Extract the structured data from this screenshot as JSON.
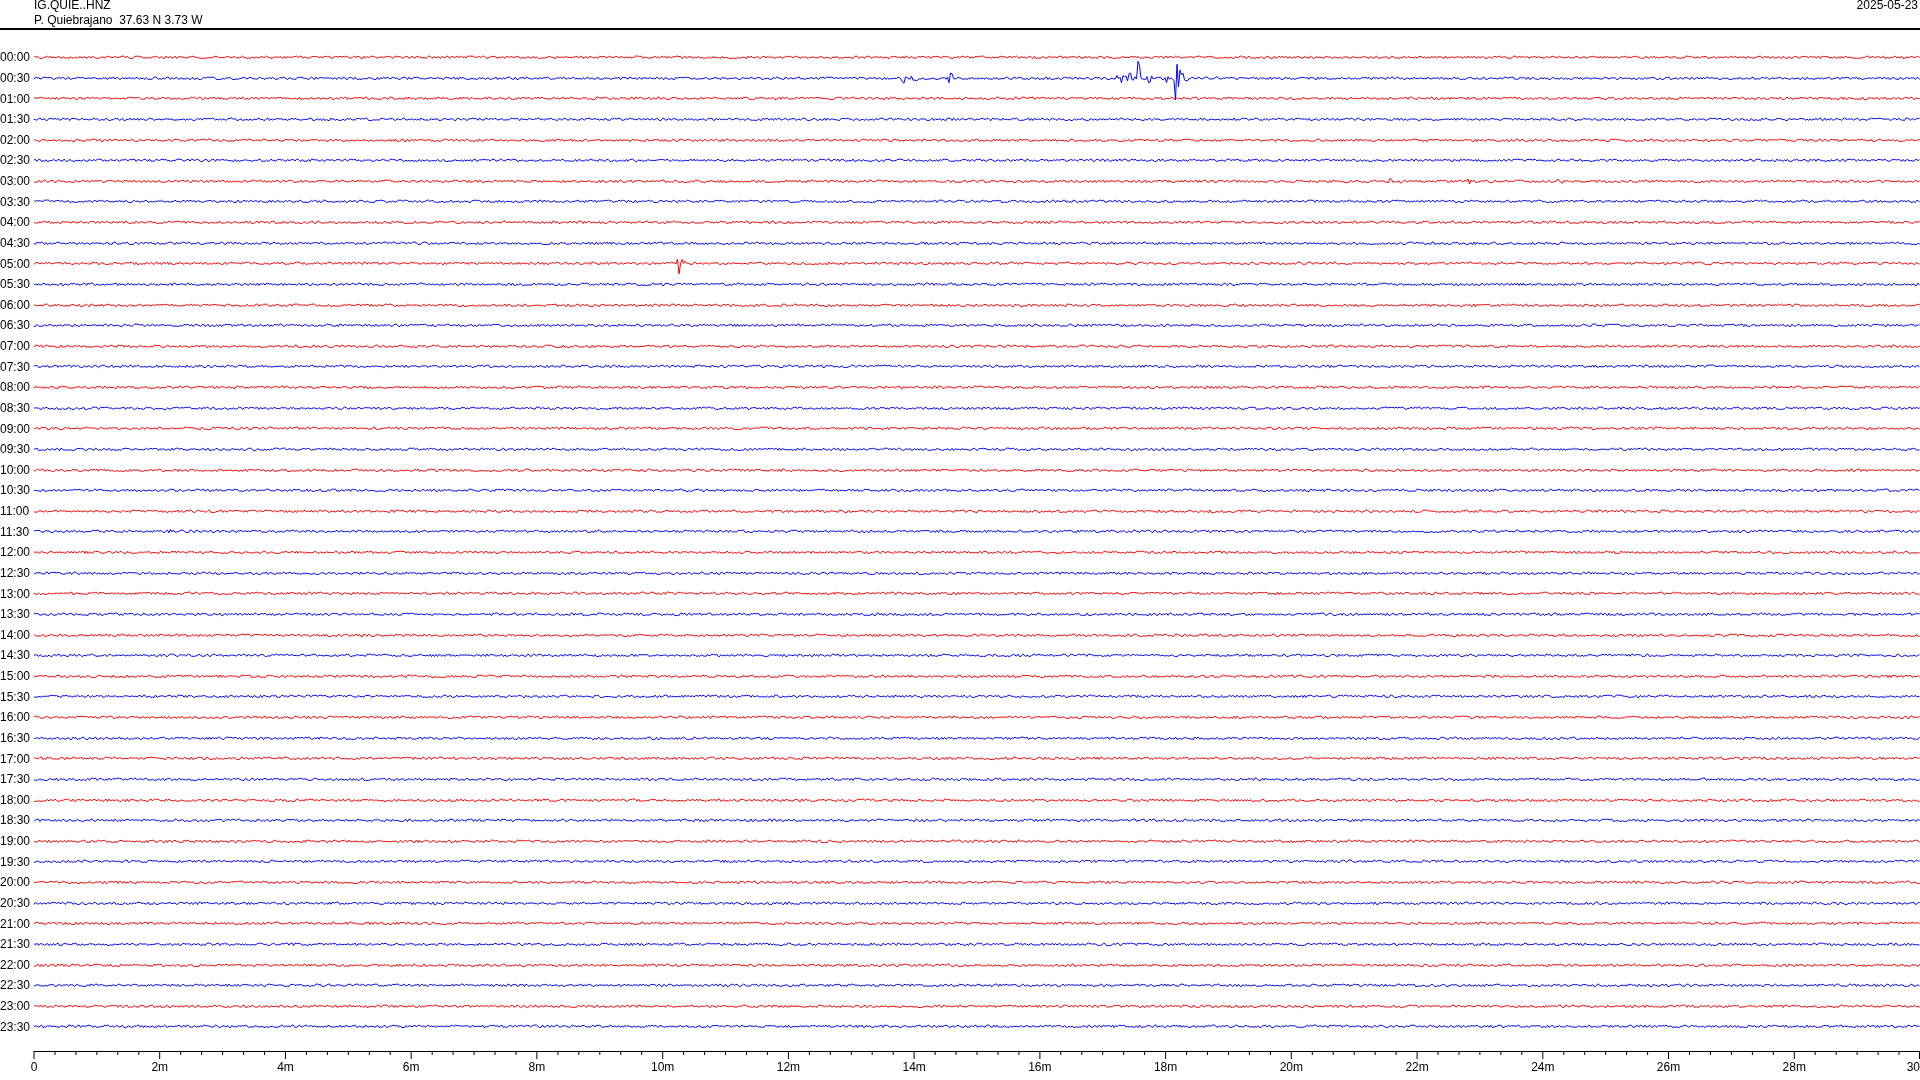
{
  "header": {
    "channel": "IG.QUIE..HNZ",
    "station": "P. Quiebrajano  37.63 N 3.73 W",
    "date": "2025-05-23"
  },
  "traces": [
    {
      "label": "00:00",
      "color": "#ff0000"
    },
    {
      "label": "00:30",
      "color": "#0000ff"
    },
    {
      "label": "01:00",
      "color": "#ff0000"
    },
    {
      "label": "01:30",
      "color": "#0000ff"
    },
    {
      "label": "02:00",
      "color": "#ff0000"
    },
    {
      "label": "02:30",
      "color": "#0000ff"
    },
    {
      "label": "03:00",
      "color": "#ff0000"
    },
    {
      "label": "03:30",
      "color": "#0000ff"
    },
    {
      "label": "04:00",
      "color": "#ff0000"
    },
    {
      "label": "04:30",
      "color": "#0000ff"
    },
    {
      "label": "05:00",
      "color": "#ff0000"
    },
    {
      "label": "05:30",
      "color": "#0000ff"
    },
    {
      "label": "06:00",
      "color": "#ff0000"
    },
    {
      "label": "06:30",
      "color": "#0000ff"
    },
    {
      "label": "07:00",
      "color": "#ff0000"
    },
    {
      "label": "07:30",
      "color": "#0000ff"
    },
    {
      "label": "08:00",
      "color": "#ff0000"
    },
    {
      "label": "08:30",
      "color": "#0000ff"
    },
    {
      "label": "09:00",
      "color": "#ff0000"
    },
    {
      "label": "09:30",
      "color": "#0000ff"
    },
    {
      "label": "10:00",
      "color": "#ff0000"
    },
    {
      "label": "10:30",
      "color": "#0000ff"
    },
    {
      "label": "11:00",
      "color": "#ff0000"
    },
    {
      "label": "11:30",
      "color": "#0000ff"
    },
    {
      "label": "12:00",
      "color": "#ff0000"
    },
    {
      "label": "12:30",
      "color": "#0000ff"
    },
    {
      "label": "13:00",
      "color": "#ff0000"
    },
    {
      "label": "13:30",
      "color": "#0000ff"
    },
    {
      "label": "14:00",
      "color": "#ff0000"
    },
    {
      "label": "14:30",
      "color": "#0000ff"
    },
    {
      "label": "15:00",
      "color": "#ff0000"
    },
    {
      "label": "15:30",
      "color": "#0000ff"
    },
    {
      "label": "16:00",
      "color": "#ff0000"
    },
    {
      "label": "16:30",
      "color": "#0000ff"
    },
    {
      "label": "17:00",
      "color": "#ff0000"
    },
    {
      "label": "17:30",
      "color": "#0000ff"
    },
    {
      "label": "18:00",
      "color": "#ff0000"
    },
    {
      "label": "18:30",
      "color": "#0000ff"
    },
    {
      "label": "19:00",
      "color": "#ff0000"
    },
    {
      "label": "19:30",
      "color": "#0000ff"
    },
    {
      "label": "20:00",
      "color": "#ff0000"
    },
    {
      "label": "20:30",
      "color": "#0000ff"
    },
    {
      "label": "21:00",
      "color": "#ff0000"
    },
    {
      "label": "21:30",
      "color": "#0000ff"
    },
    {
      "label": "22:00",
      "color": "#ff0000"
    },
    {
      "label": "22:30",
      "color": "#0000ff"
    },
    {
      "label": "23:00",
      "color": "#ff0000"
    },
    {
      "label": "23:30",
      "color": "#0000ff"
    }
  ],
  "axis_labels": [
    "0",
    "2m",
    "4m",
    "6m",
    "8m",
    "10m",
    "12m",
    "14m",
    "16m",
    "18m",
    "20m",
    "22m",
    "24m",
    "26m",
    "28m",
    "30"
  ]
}
